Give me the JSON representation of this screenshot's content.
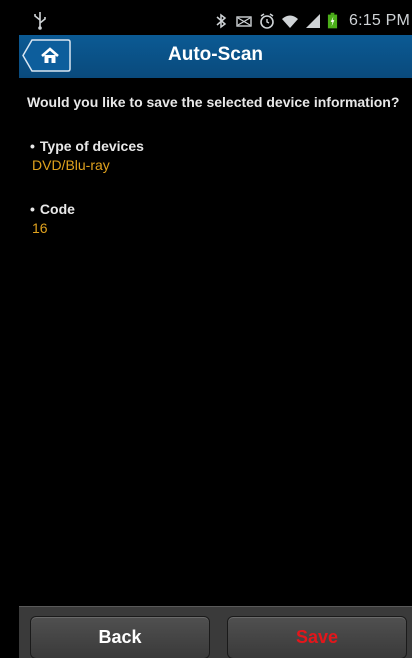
{
  "statusbar": {
    "time": "6:15 PM",
    "icons": [
      "usb-icon",
      "bluetooth-icon",
      "no-signal-icon",
      "alarm-icon",
      "wifi-icon",
      "signal-icon",
      "battery-icon"
    ]
  },
  "titlebar": {
    "title": "Auto-Scan",
    "home_icon": "home-icon",
    "accent": "#0b5a94"
  },
  "main": {
    "question": "Would you like to save the selected device information?",
    "fields": [
      {
        "label": "Type of devices",
        "value": "DVD/Blu-ray"
      },
      {
        "label": "Code",
        "value": "16"
      }
    ],
    "value_color": "#e0a21e"
  },
  "footer": {
    "back_label": "Back",
    "save_label": "Save",
    "save_color": "#e4161b"
  }
}
